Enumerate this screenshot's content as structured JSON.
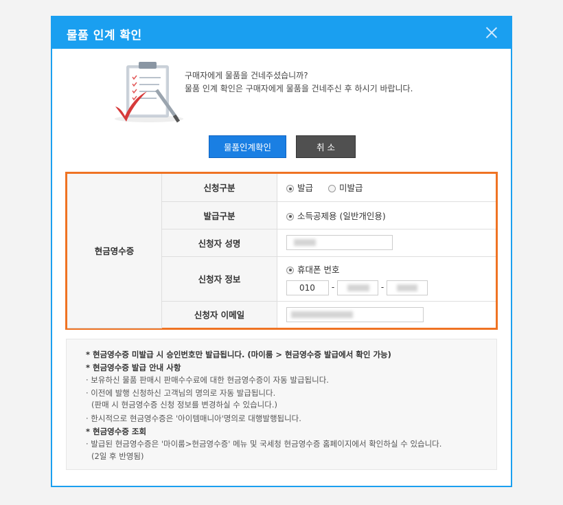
{
  "dialog": {
    "title": "물품 인계 확인",
    "close_label": "닫기",
    "message_line1": "구매자에게 물품을 건네주셨습니까?",
    "message_line2": "물품 인계 확인은 구매자에게 물품을 건네주신 후 하시기 바랍니다.",
    "confirm_button": "물품인계확인",
    "cancel_button": "취 소"
  },
  "form": {
    "section_label": "현금영수증",
    "rows": [
      {
        "label": "신청구분",
        "options": [
          "발급",
          "미발급"
        ],
        "selected": "발급"
      },
      {
        "label": "발급구분",
        "options": [
          "소득공제용 (일반개인용)"
        ],
        "selected": "소득공제용 (일반개인용)"
      },
      {
        "label": "신청자 성명"
      },
      {
        "label": "신청자 정보",
        "options": [
          "휴대폰 번호"
        ],
        "selected": "휴대폰 번호",
        "phone_prefix": "010",
        "separator": "-"
      },
      {
        "label": "신청자 이메일"
      }
    ]
  },
  "notes": {
    "line1": "* 현금영수증 미발급 시 승인번호만 발급됩니다. (마이룸 > 현금영수증 발급에서 확인 가능)",
    "line2": "* 현금영수증 발급 안내 사항",
    "line3": "· 보유하신 물품 판매시 판매수수료에 대한 현금영수증이 자동 발급됩니다.",
    "line4": "· 이전에 발행 신청하신 고객님의 명의로 자동 발급됩니다.",
    "line5": "(판매 시 현금영수증 신청 정보를 변경하실 수 있습니다.)",
    "line6": "· 한시적으로 현금영수증은 '아이템매니아'명의로 대행발행됩니다.",
    "line7": "* 현금영수증 조회",
    "line8": "· 발급된 현금영수증은 '마이룸>현금영수증' 메뉴 및 국세청 현금영수증 홈페이지에서 확인하실 수 있습니다.",
    "line9": "(2일 후 반영됨)"
  },
  "colors": {
    "title_bar": "#1a9ff0",
    "confirm": "#1a7fe3",
    "cancel": "#505050",
    "highlight_border": "#ef7323"
  }
}
